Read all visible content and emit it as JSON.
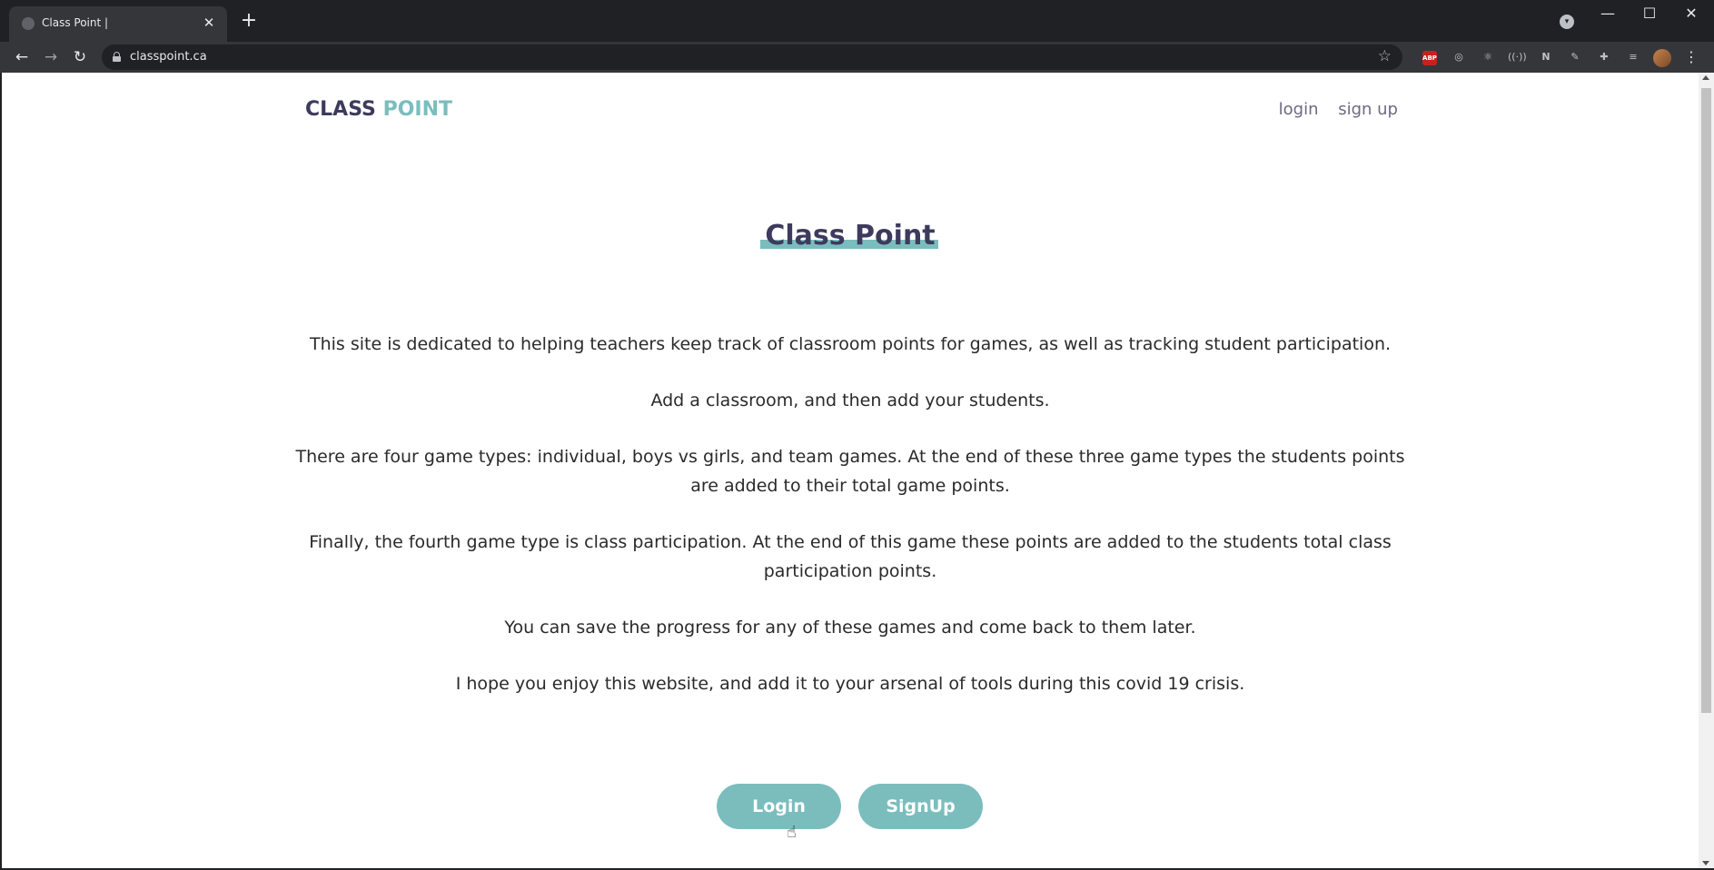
{
  "browser": {
    "tab_title": "Class Point |",
    "url": "classpoint.ca",
    "icons": {
      "back": "arrow-left-icon",
      "forward": "arrow-right-icon",
      "reload": "reload-icon",
      "bookmark": "star-icon",
      "extensions": "puzzle-icon",
      "menu": "more-vertical-icon"
    },
    "ext_abp_label": "ABP"
  },
  "header": {
    "logo_part1": "CLASS",
    "logo_part2": "POINT",
    "nav": {
      "login": "login",
      "signup": "sign up"
    }
  },
  "hero": {
    "title": "Class Point"
  },
  "intro": {
    "p1": "This site is dedicated to helping teachers keep track of classroom points for games, as well as tracking student participation.",
    "p2": "Add a classroom, and then add your students.",
    "p3": "There are four game types: individual, boys vs girls, and team games. At the end of these three game types the students points are added to their total game points.",
    "p4": "Finally, the fourth game type is class participation. At the end of this game these points are added to the students total class participation points.",
    "p5": "You can save the progress for any of these games and come back to them later.",
    "p6": "I hope you enjoy this website, and add it to your arsenal of tools during this covid 19 crisis."
  },
  "actions": {
    "login": "Login",
    "signup": "SignUp"
  },
  "colors": {
    "brand_dark": "#3d3a5e",
    "brand_teal": "#7bbdbd"
  }
}
